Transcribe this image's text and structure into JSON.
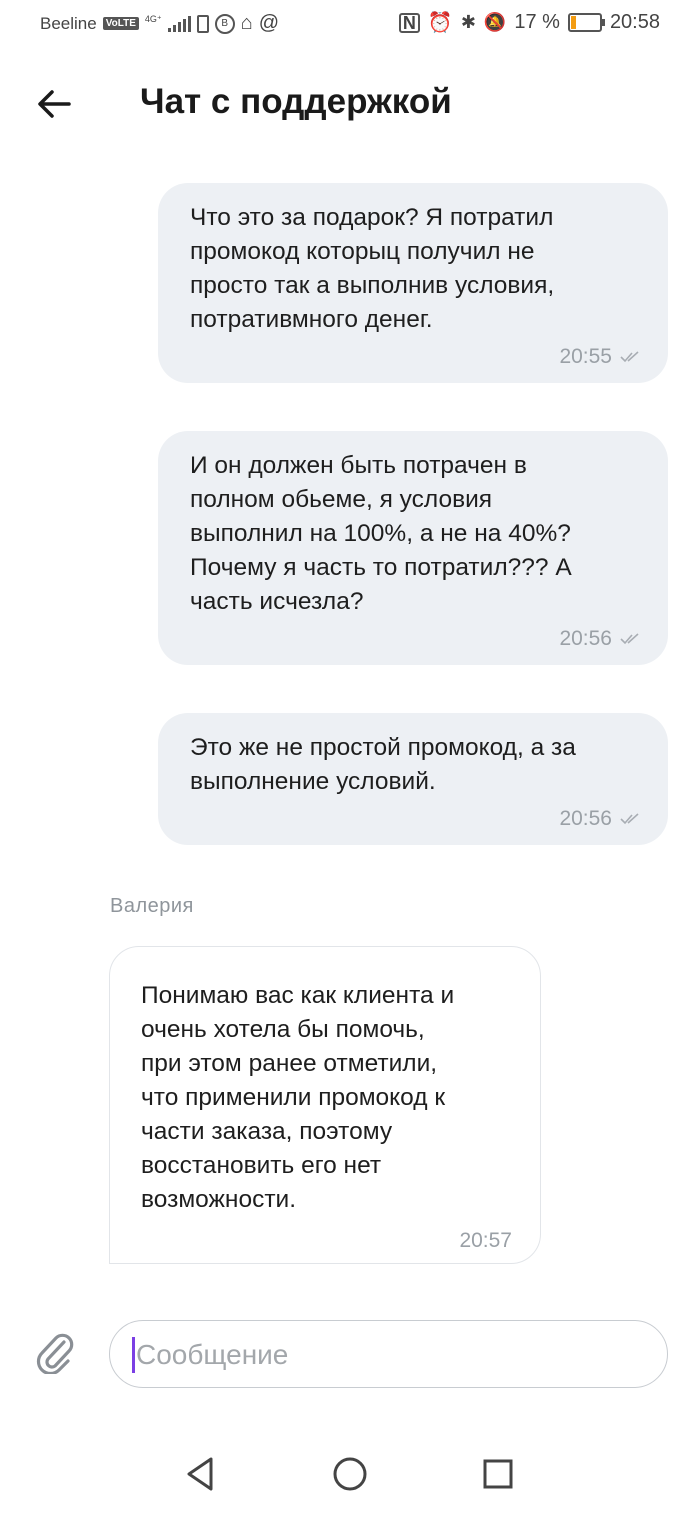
{
  "status_bar": {
    "carrier": "Beeline",
    "volte": "VoLTE",
    "network": "4G⁺",
    "battery_percent": "17 %",
    "time": "20:58",
    "battery_level": 0.17
  },
  "header": {
    "title": "Чат с поддержкой",
    "back_icon": "arrow-left-icon"
  },
  "messages": [
    {
      "direction": "outgoing",
      "text": "Что это за подарок? Я потратил\nпромокод которыц получил не\nпросто так а выполнив условия,\nпотративмного денег.",
      "time": "20:55"
    },
    {
      "direction": "outgoing",
      "text": "И он должен быть потрачен в\nполном обьеме, я условия\nвыполнил на 100%, а не на 40%?\nПочему я часть то потратил??? А\nчасть исчезла?",
      "time": "20:56"
    },
    {
      "direction": "outgoing",
      "text": "Это же не простой промокод, а за\nвыполнение условий.",
      "time": "20:56"
    },
    {
      "direction": "incoming",
      "sender": "Валерия",
      "text": "Понимаю вас как клиента и\nочень хотела бы помочь,\nпри этом ранее отметили,\nчто применили промокод к\nчасти заказа, поэтому\nвосстановить его нет\nвозможности.",
      "time": "20:57"
    }
  ],
  "composer": {
    "placeholder": "Сообщение",
    "value": "",
    "attach_icon": "paperclip-icon"
  },
  "nav_bar": {
    "back": "triangle-back-icon",
    "home": "circle-home-icon",
    "recents": "square-recents-icon"
  },
  "colors": {
    "outgoing_bubble": "#edf0f4",
    "incoming_border": "#e2e5e9",
    "caret": "#7b3fe4",
    "battery": "#f39c12"
  }
}
